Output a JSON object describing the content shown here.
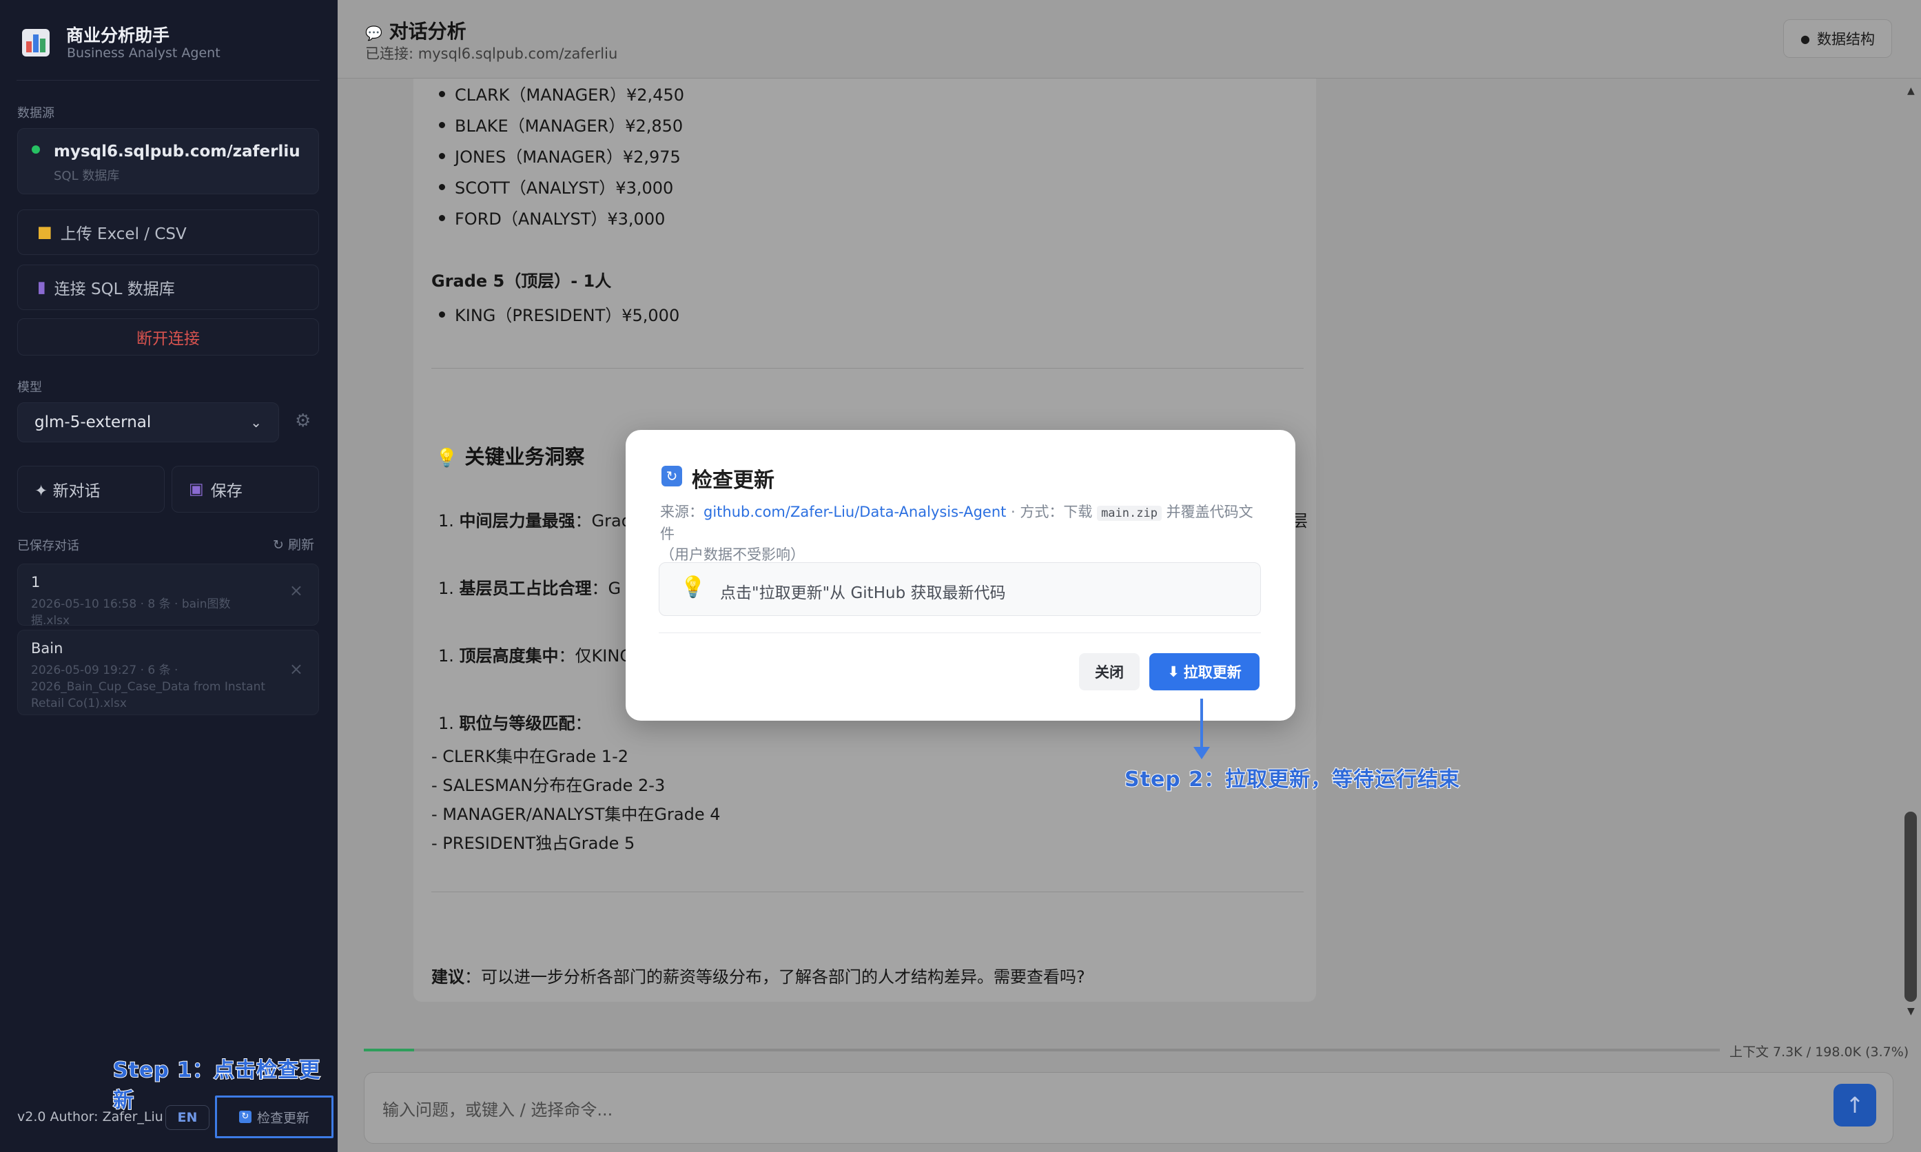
{
  "sidebar": {
    "brand_title": "商业分析助手",
    "brand_subtitle": "Business Analyst Agent",
    "datasource_label": "数据源",
    "connection": {
      "host": "mysql6.sqlpub.com/zaferliu",
      "type": "SQL 数据库",
      "status_color": "#27c163"
    },
    "upload_label": "上传 Excel / CSV",
    "connect_sql_label": "连接 SQL 数据库",
    "disconnect_label": "断开连接",
    "model_label": "模型",
    "model_value": "glm-5-external",
    "new_chat_label": "✦ 新对话",
    "save_label": "保存",
    "saved_chats_label": "已保存对话",
    "refresh_label": "↻ 刷新",
    "saved_chats": [
      {
        "title": "1",
        "meta": "2026-05-10 16:58 · 8 条 · bain图数据.xlsx"
      },
      {
        "title": "Bain",
        "meta": "2026-05-09 19:27 · 6 条 · 2026_Bain_Cup_Case_Data from Instant Retail Co(1).xlsx"
      }
    ],
    "step1_annotation": "Step 1：点击检查更新",
    "version": "v2.0 Author: Zafer_Liu",
    "lang_button": "EN",
    "check_update_button": "检查更新"
  },
  "header": {
    "title": "对话分析",
    "subtitle": "已连接: mysql6.sqlpub.com/zaferliu",
    "schema_button": "数据结构"
  },
  "message": {
    "grade4_list": [
      "CLARK（MANAGER）¥2,450",
      "BLAKE（MANAGER）¥2,850",
      "JONES（MANAGER）¥2,975",
      "SCOTT（ANALYST）¥3,000",
      "FORD（ANALYST）¥3,000"
    ],
    "grade5_heading": "Grade 5（顶层）- 1人",
    "grade5_list": [
      "KING（PRESIDENT）¥5,000"
    ],
    "insights_heading": "关键业务洞察",
    "insight1_bold": "中间层力量最强",
    "insight1_rest": "：Grad",
    "insight1_tail": "层",
    "insight2_bold": "基层员工占比合理",
    "insight2_rest": "：G",
    "insight3_bold": "顶层高度集中",
    "insight3_rest": "：仅KING",
    "insight4_bold": "职位与等级匹配",
    "insight4_rest": "：",
    "insight_number": "1.",
    "matching_lines": [
      "- CLERK集中在Grade 1-2",
      "- SALESMAN分布在Grade 2-3",
      "- MANAGER/ANALYST集中在Grade 4",
      "- PRESIDENT独占Grade 5"
    ],
    "suggestion_bold": "建议",
    "suggestion_rest": "：可以进一步分析各部门的薪资等级分布，了解各部门的人才结构差异。需要查看吗?"
  },
  "footer": {
    "context_usage": "上下文 7.3K / 198.0K (3.7%)",
    "context_fraction": 0.037,
    "input_placeholder": "输入问题，或键入 / 选择命令...",
    "send_icon": "↑"
  },
  "modal": {
    "title": "检查更新",
    "source_prefix": "来源：",
    "source_link": "github.com/Zafer-Liu/Data-Analysis-Agent",
    "method_text": " · 方式：下载 ",
    "method_code": "main.zip",
    "method_suffix": " 并覆盖代码文件",
    "note": "（用户数据不受影响）",
    "hint": "点击\"拉取更新\"从 GitHub 获取最新代码",
    "close_button": "关闭",
    "pull_button": "拉取更新"
  },
  "step2_annotation": "Step 2：拉取更新，等待运行结束",
  "colors": {
    "accent": "#2f74ea",
    "annotation": "#2f6ad9",
    "danger": "#d9534f",
    "sidebar_bg": "#161a2a"
  }
}
